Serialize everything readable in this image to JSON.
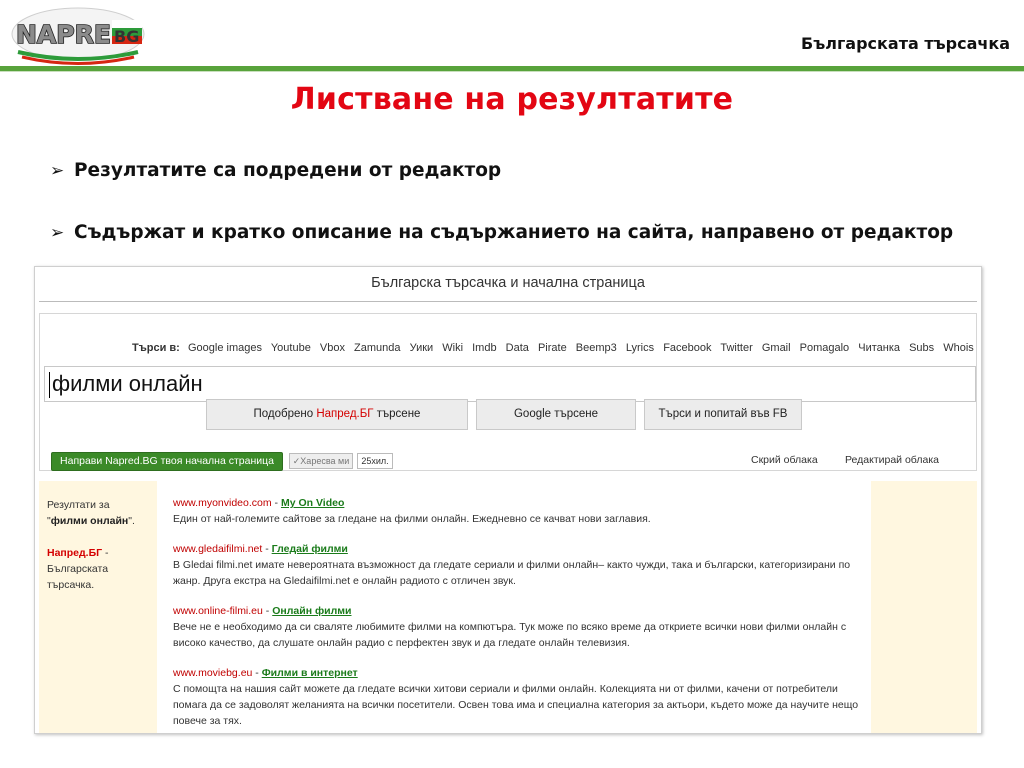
{
  "header": {
    "logo_text": "NAPRED.BG",
    "right_label": "Българската търсачка"
  },
  "slide": {
    "title": "Листване на резултатите",
    "bullets": [
      "Резултатите са подредени от редактор",
      "Съдържат и кратко описание на съдържанието на сайта, направено от редактор"
    ]
  },
  "screenshot": {
    "page_title": "Българска търсачка и начална страница",
    "search_in_label": "Търси в:",
    "search_links": [
      "Google images",
      "Youtube",
      "Vbox",
      "Zamunda",
      "Уики",
      "Wiki",
      "Imdb",
      "Data",
      "Pirate",
      "Beemp3",
      "Lyrics",
      "Facebook",
      "Twitter",
      "Gmail",
      "Pomagalo",
      "Читанка",
      "Subs",
      "Whois"
    ],
    "query": "филми онлайн",
    "buttons": {
      "improved_prefix": "Подобрено ",
      "improved_brand": "Напред.БГ",
      "improved_suffix": " търсене",
      "google": "Google търсене",
      "fb": "Търси и попитай във FB"
    },
    "home_button": "Направи Napred.BG твоя начална страница",
    "like_button": "✓Харесва ми",
    "like_count": "25хил.",
    "hide_clouds": "Скрий облака",
    "edit_clouds": "Редактирай облака",
    "sidebar": {
      "results_for_prefix": "Резултати за \"",
      "results_for_query": "филми онлайн",
      "results_for_suffix": "\".",
      "brand": "Напред.БГ",
      "brand_desc": " - Българската търсачка."
    },
    "results": [
      {
        "url": "www.myonvideo.com",
        "title": "My On Video",
        "desc": "Един от най-големите сайтове за гледане на филми онлайн. Ежедневно се качват нови заглавия."
      },
      {
        "url": "www.gledaifilmi.net",
        "title": "Гледай филми",
        "desc": "В Gledai filmi.net имате невероятната възможност да гледате сериали и филми онлайн– както чужди, така и български, категоризирани по жанр. Друга екстра на Gledaifilmi.net е онлайн радиото с отличен звук."
      },
      {
        "url": "www.online-filmi.eu",
        "title": "Онлайн филми",
        "desc": "Вече не е необходимо да си сваляте любимите филми на компютъра. Тук може по всяко време да откриете всички нови филми онлайн с високо качество, да слушате онлайн радио с перфектен звук и да гледате онлайн телевизия."
      },
      {
        "url": "www.moviebg.eu",
        "title": "Филми в интернет",
        "desc": "С помощта на нашия сайт можете да гледате всички хитови сериали и филми онлайн. Колекцията ни от филми, качени от потребители помага да се задоволят желанията на всички посетители. Освен това има и специална категория за актьори, където може да научите нещо повече за тях."
      }
    ]
  }
}
